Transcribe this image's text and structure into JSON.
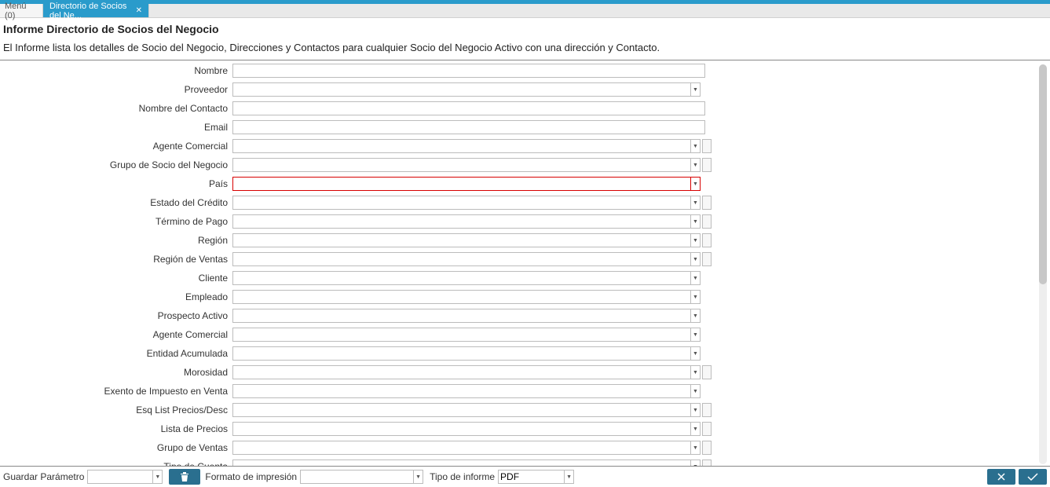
{
  "accent_color": "#2a9bcb",
  "button_color": "#2a6f8f",
  "highlight_color": "#d80000",
  "tabs": {
    "menu": "Menú (0)",
    "active": "Directorio de Socios del Ne..."
  },
  "title": "Informe Directorio de Socios del Negocio",
  "description": "El Informe lista los detalles de Socio del Negocio, Direcciones y Contactos para cualquier Socio del Negocio Activo con una dirección y Contacto.",
  "fields": [
    {
      "label": "Nombre",
      "type": "text",
      "value": ""
    },
    {
      "label": "Proveedor",
      "type": "combo",
      "value": ""
    },
    {
      "label": "Nombre del Contacto",
      "type": "text",
      "value": ""
    },
    {
      "label": "Email",
      "type": "text",
      "value": ""
    },
    {
      "label": "Agente Comercial",
      "type": "combo_extra",
      "value": ""
    },
    {
      "label": "Grupo de Socio del Negocio",
      "type": "combo_extra",
      "value": ""
    },
    {
      "label": "País",
      "type": "combo",
      "value": "",
      "highlight": true
    },
    {
      "label": "Estado del Crédito",
      "type": "combo_extra",
      "value": ""
    },
    {
      "label": "Término de Pago",
      "type": "combo_extra",
      "value": ""
    },
    {
      "label": "Región",
      "type": "combo_extra",
      "value": ""
    },
    {
      "label": "Región de Ventas",
      "type": "combo_extra",
      "value": ""
    },
    {
      "label": "Cliente",
      "type": "combo",
      "value": ""
    },
    {
      "label": "Empleado",
      "type": "combo",
      "value": ""
    },
    {
      "label": "Prospecto Activo",
      "type": "combo",
      "value": ""
    },
    {
      "label": "Agente Comercial",
      "type": "combo",
      "value": ""
    },
    {
      "label": "Entidad Acumulada",
      "type": "combo",
      "value": ""
    },
    {
      "label": "Morosidad",
      "type": "combo_extra",
      "value": ""
    },
    {
      "label": "Exento de Impuesto en Venta",
      "type": "combo",
      "value": ""
    },
    {
      "label": "Esq List Precios/Desc",
      "type": "combo_extra",
      "value": ""
    },
    {
      "label": "Lista de Precios",
      "type": "combo_extra",
      "value": ""
    },
    {
      "label": "Grupo de Ventas",
      "type": "combo_extra",
      "value": ""
    },
    {
      "label": "Tipo de Cuenta",
      "type": "combo_extra",
      "value": ""
    }
  ],
  "footer": {
    "save_param_label": "Guardar Parámetro",
    "save_param_value": "",
    "print_format_label": "Formato de impresión",
    "print_format_value": "",
    "report_type_label": "Tipo de informe",
    "report_type_value": "PDF"
  }
}
